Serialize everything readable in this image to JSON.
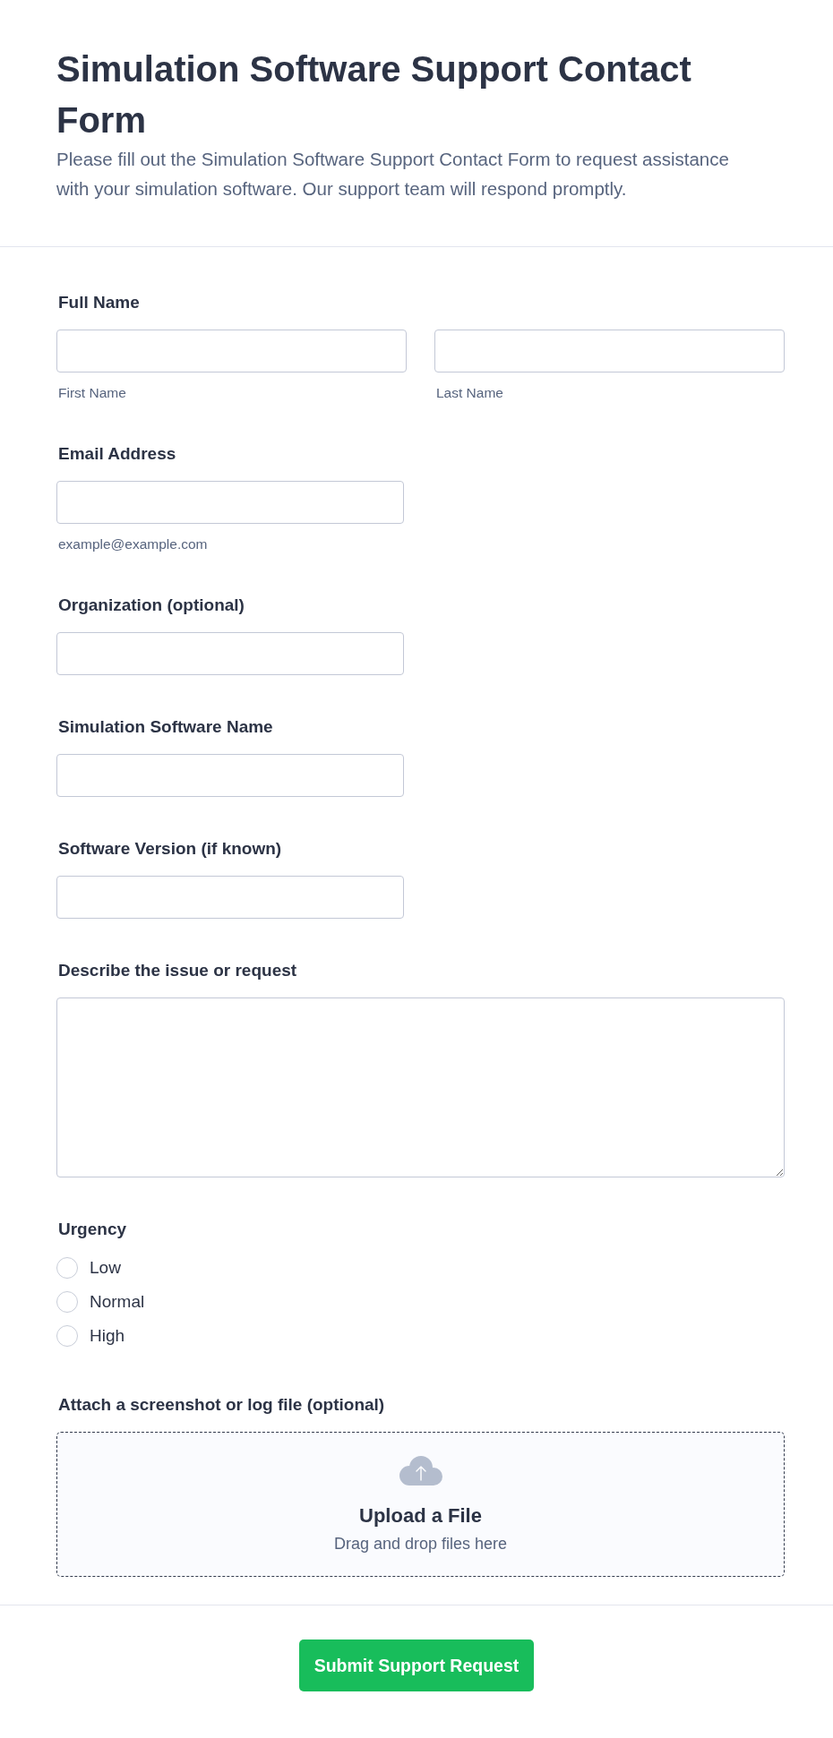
{
  "header": {
    "title": "Simulation Software Support Contact Form",
    "description": "Please fill out the Simulation Software Support Contact Form to request assistance with your simulation software. Our support team will respond promptly."
  },
  "fields": [
    {
      "kind": "name",
      "label": "Full Name",
      "inputs": [
        {
          "sublabel": "First Name"
        },
        {
          "sublabel": "Last Name"
        }
      ]
    },
    {
      "kind": "text",
      "label": "Email Address",
      "hint": "example@example.com"
    },
    {
      "kind": "text",
      "label": "Organization (optional)"
    },
    {
      "kind": "text",
      "label": "Simulation Software Name"
    },
    {
      "kind": "text",
      "label": "Software Version (if known)"
    },
    {
      "kind": "textarea",
      "label": "Describe the issue or request"
    },
    {
      "kind": "radio",
      "label": "Urgency",
      "options": [
        {
          "label": "Low",
          "selected": false
        },
        {
          "label": "Normal",
          "selected": false
        },
        {
          "label": "High",
          "selected": false
        }
      ]
    },
    {
      "kind": "upload",
      "label": "Attach a screenshot or log file (optional)",
      "title": "Upload a File",
      "subtitle": "Drag and drop files here"
    }
  ],
  "submit_button": {
    "label": "Submit Support Request"
  }
}
